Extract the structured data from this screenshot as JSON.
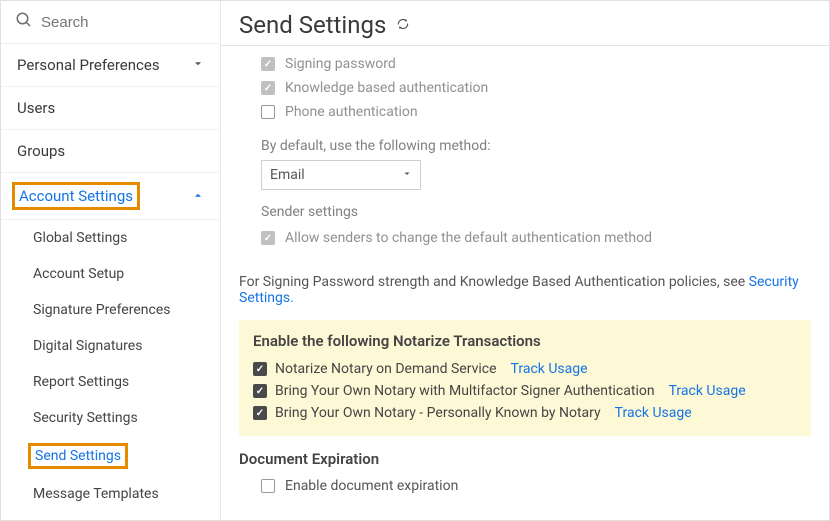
{
  "search": {
    "placeholder": "Search"
  },
  "sidebar": {
    "personal": "Personal Preferences",
    "users": "Users",
    "groups": "Groups",
    "account": "Account Settings",
    "sub": {
      "global": "Global Settings",
      "setup": "Account Setup",
      "sigpref": "Signature Preferences",
      "digital": "Digital Signatures",
      "report": "Report Settings",
      "security": "Security Settings",
      "send": "Send Settings",
      "templates": "Message Templates"
    }
  },
  "page": {
    "title": "Send Settings",
    "auth": {
      "signing_password": "Signing password",
      "kba": "Knowledge based authentication",
      "phone": "Phone authentication"
    },
    "default_method": {
      "label": "By default, use the following method:",
      "selected": "Email"
    },
    "sender": {
      "label": "Sender settings",
      "allow_change": "Allow senders to change the default authentication method"
    },
    "policy_line_1": "For Signing Password strength and Knowledge Based Authentication policies, see ",
    "policy_link": "Security Settings.",
    "notarize": {
      "title": "Enable the following Notarize Transactions",
      "opt1": "Notarize Notary on Demand Service",
      "opt2": "Bring Your Own Notary with Multifactor Signer Authentication",
      "opt3": "Bring Your Own Notary - Personally Known by Notary",
      "track": "Track Usage"
    },
    "expiration": {
      "title": "Document Expiration",
      "enable": "Enable document expiration"
    }
  }
}
